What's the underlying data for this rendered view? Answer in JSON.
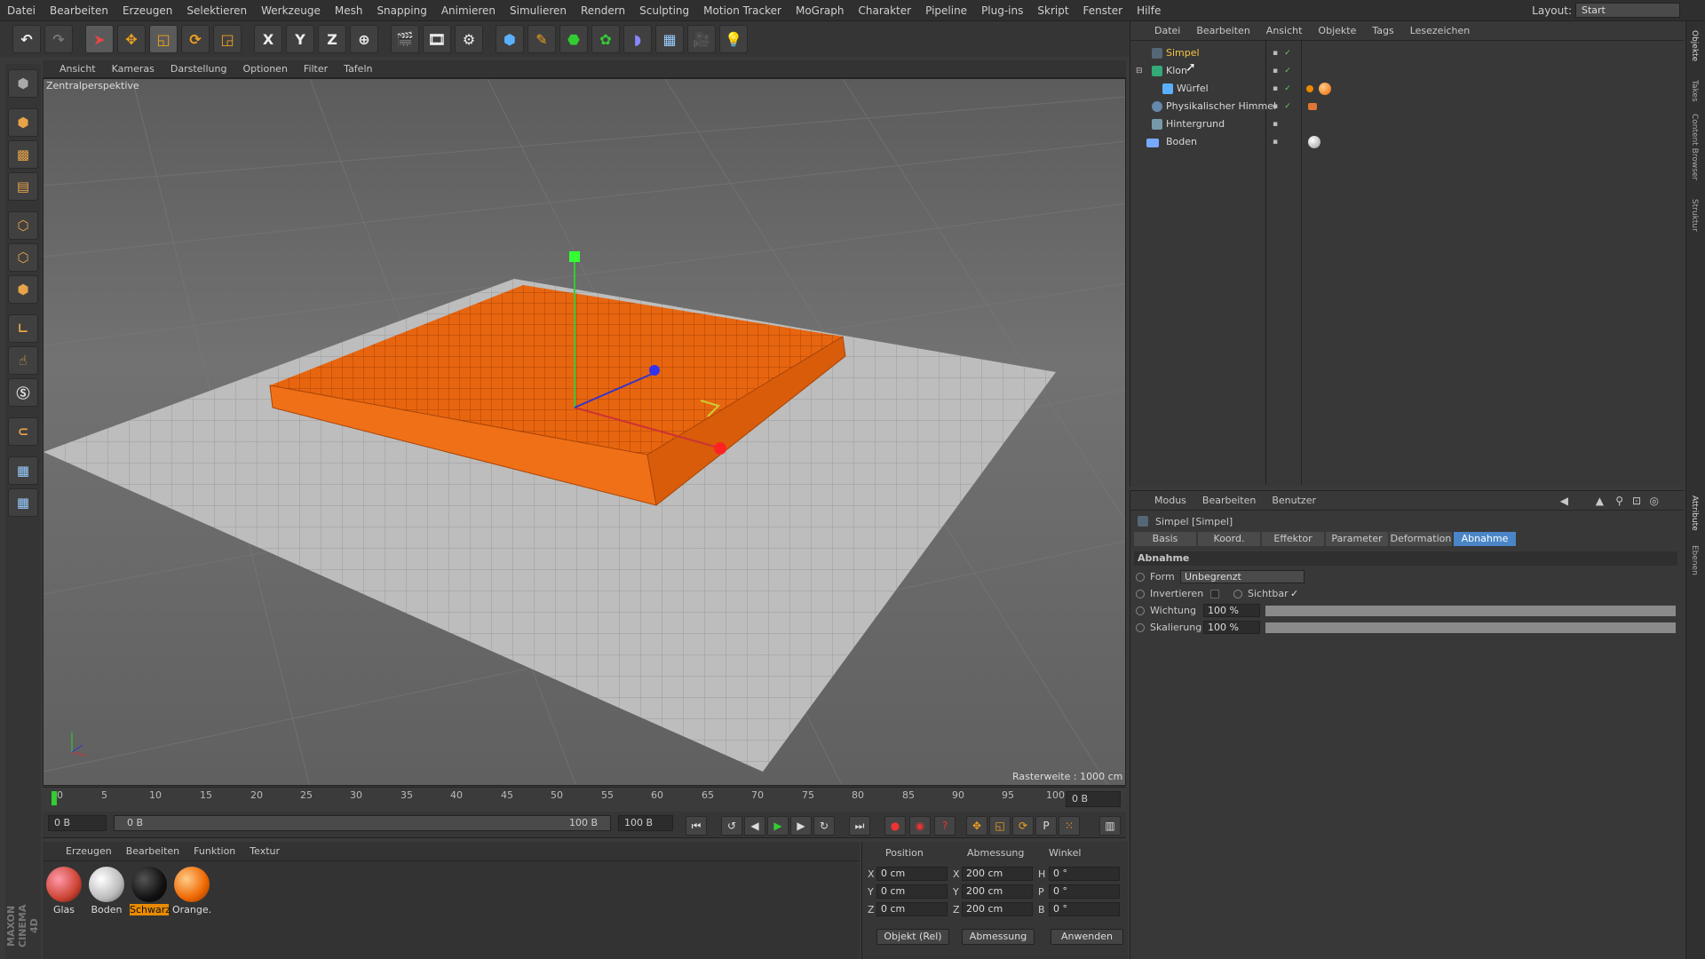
{
  "menubar": {
    "items": [
      "Datei",
      "Bearbeiten",
      "Erzeugen",
      "Selektieren",
      "Werkzeuge",
      "Mesh",
      "Snapping",
      "Animieren",
      "Simulieren",
      "Rendern",
      "Sculpting",
      "Motion Tracker",
      "MoGraph",
      "Charakter",
      "Pipeline",
      "Plug-ins",
      "Skript",
      "Fenster",
      "Hilfe"
    ]
  },
  "layout": {
    "label": "Layout:",
    "value": "Start"
  },
  "toolbar": {
    "x": "X",
    "y": "Y",
    "z": "Z"
  },
  "viewport_menu": [
    "Ansicht",
    "Kameras",
    "Darstellung",
    "Optionen",
    "Filter",
    "Tafeln"
  ],
  "viewport": {
    "camera_label": "Zentralperspektive",
    "grid_size": "Rasterweite : 1000 cm"
  },
  "timeline": {
    "ticks": [
      "0",
      "5",
      "10",
      "15",
      "20",
      "25",
      "30",
      "35",
      "40",
      "45",
      "50",
      "55",
      "60",
      "65",
      "70",
      "75",
      "80",
      "85",
      "90",
      "95",
      "100"
    ],
    "current_frame": "0 B",
    "start": "0 B",
    "range_start": "0 B",
    "range_end": "100 B",
    "end": "100 B"
  },
  "materials": {
    "menu": [
      "Erzeugen",
      "Bearbeiten",
      "Funktion",
      "Textur"
    ],
    "items": [
      "Glas",
      "Boden",
      "Schwarz",
      "Orange."
    ]
  },
  "coords": {
    "headers": [
      "Position",
      "Abmessung",
      "Winkel"
    ],
    "rows": [
      {
        "axis": "X",
        "pos": "0 cm",
        "size_axis": "X",
        "size": "200 cm",
        "rot_axis": "H",
        "rot": "0 °"
      },
      {
        "axis": "Y",
        "pos": "0 cm",
        "size_axis": "Y",
        "size": "200 cm",
        "rot_axis": "P",
        "rot": "0 °"
      },
      {
        "axis": "Z",
        "pos": "0 cm",
        "size_axis": "Z",
        "size": "200 cm",
        "rot_axis": "B",
        "rot": "0 °"
      }
    ],
    "mode": "Objekt (Rel)",
    "size_mode": "Abmessung",
    "apply": "Anwenden"
  },
  "objects": {
    "menu": [
      "Datei",
      "Bearbeiten",
      "Ansicht",
      "Objekte",
      "Tags",
      "Lesezeichen"
    ],
    "items": [
      "Simpel",
      "Klon",
      "Würfel",
      "Physikalischer Himmel",
      "Hintergrund",
      "Boden"
    ]
  },
  "attributes": {
    "menu": [
      "Modus",
      "Bearbeiten",
      "Benutzer"
    ],
    "title": "Simpel [Simpel]",
    "tabs": [
      "Basis",
      "Koord.",
      "Effektor",
      "Parameter",
      "Deformation",
      "Abnahme"
    ],
    "section": "Abnahme",
    "form_label": "Form",
    "form_value": "Unbegrenzt",
    "invert_label": "Invertieren",
    "visible_label": "Sichtbar",
    "weight_label": "Wichtung",
    "weight_value": "100 %",
    "scale_label": "Skalierung",
    "scale_value": "100 %"
  },
  "right_tabs": [
    "Objekte",
    "Takes",
    "Content Browser",
    "Struktur",
    "Attribute",
    "Ebenen"
  ],
  "maxon": "MAXON CINEMA 4D"
}
